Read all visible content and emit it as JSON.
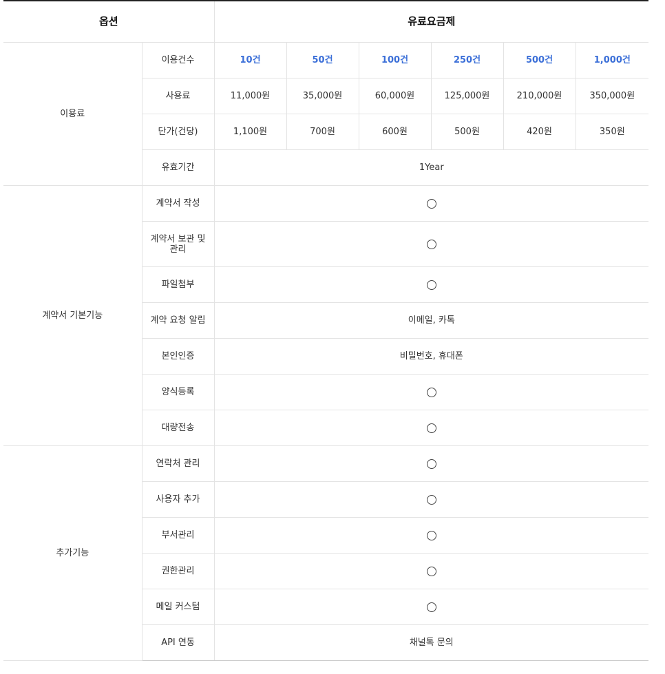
{
  "header": {
    "option": "옵션",
    "paid_plan": "유료요금제"
  },
  "fee": {
    "group_label": "이용료",
    "count_label": "이용건수",
    "counts": [
      "10건",
      "50건",
      "100건",
      "250건",
      "500건",
      "1,000건"
    ],
    "price_label": "사용료",
    "prices": [
      "11,000원",
      "35,000원",
      "60,000원",
      "125,000원",
      "210,000원",
      "350,000원"
    ],
    "unit_label": "단가(건당)",
    "unit_prices": [
      "1,100원",
      "700원",
      "600원",
      "500원",
      "420원",
      "350원"
    ],
    "validity_label": "유효기간",
    "validity_value": "1Year"
  },
  "basic": {
    "group_label": "계약서 기본기능",
    "rows": [
      {
        "label": "계약서 작성",
        "value": "○"
      },
      {
        "label": "계약서 보관 및 관리",
        "value": "○"
      },
      {
        "label": "파일첨부",
        "value": "○"
      },
      {
        "label": "계약 요청 알림",
        "value": "이메일, 카톡"
      },
      {
        "label": "본인인증",
        "value": "비밀번호, 휴대폰"
      },
      {
        "label": "양식등록",
        "value": "○"
      },
      {
        "label": "대량전송",
        "value": "○"
      }
    ]
  },
  "extra": {
    "group_label": "추가기능",
    "rows": [
      {
        "label": "연락처 관리",
        "value": "○"
      },
      {
        "label": "사용자 추가",
        "value": "○"
      },
      {
        "label": "부서관리",
        "value": "○"
      },
      {
        "label": "권한관리",
        "value": "○"
      },
      {
        "label": "메일 커스텀",
        "value": "○"
      },
      {
        "label": "API 연동",
        "value": "채널톡 문의"
      }
    ]
  },
  "colors": {
    "accent_blue": "#3b6fd8",
    "border": "#e3e3e3",
    "top_rule": "#222222"
  }
}
